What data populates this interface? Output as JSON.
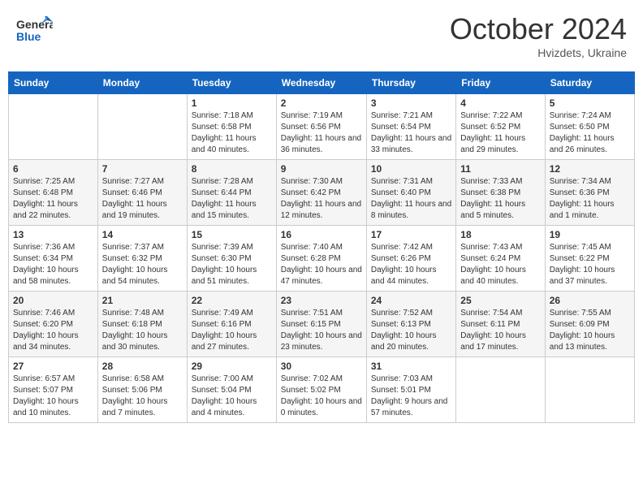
{
  "header": {
    "logo_general": "General",
    "logo_blue": "Blue",
    "month": "October 2024",
    "location": "Hvizdets, Ukraine"
  },
  "days_of_week": [
    "Sunday",
    "Monday",
    "Tuesday",
    "Wednesday",
    "Thursday",
    "Friday",
    "Saturday"
  ],
  "weeks": [
    [
      {
        "day": "",
        "sunrise": "",
        "sunset": "",
        "daylight": "",
        "empty": true
      },
      {
        "day": "",
        "sunrise": "",
        "sunset": "",
        "daylight": "",
        "empty": true
      },
      {
        "day": "1",
        "sunrise": "Sunrise: 7:18 AM",
        "sunset": "Sunset: 6:58 PM",
        "daylight": "Daylight: 11 hours and 40 minutes."
      },
      {
        "day": "2",
        "sunrise": "Sunrise: 7:19 AM",
        "sunset": "Sunset: 6:56 PM",
        "daylight": "Daylight: 11 hours and 36 minutes."
      },
      {
        "day": "3",
        "sunrise": "Sunrise: 7:21 AM",
        "sunset": "Sunset: 6:54 PM",
        "daylight": "Daylight: 11 hours and 33 minutes."
      },
      {
        "day": "4",
        "sunrise": "Sunrise: 7:22 AM",
        "sunset": "Sunset: 6:52 PM",
        "daylight": "Daylight: 11 hours and 29 minutes."
      },
      {
        "day": "5",
        "sunrise": "Sunrise: 7:24 AM",
        "sunset": "Sunset: 6:50 PM",
        "daylight": "Daylight: 11 hours and 26 minutes."
      }
    ],
    [
      {
        "day": "6",
        "sunrise": "Sunrise: 7:25 AM",
        "sunset": "Sunset: 6:48 PM",
        "daylight": "Daylight: 11 hours and 22 minutes."
      },
      {
        "day": "7",
        "sunrise": "Sunrise: 7:27 AM",
        "sunset": "Sunset: 6:46 PM",
        "daylight": "Daylight: 11 hours and 19 minutes."
      },
      {
        "day": "8",
        "sunrise": "Sunrise: 7:28 AM",
        "sunset": "Sunset: 6:44 PM",
        "daylight": "Daylight: 11 hours and 15 minutes."
      },
      {
        "day": "9",
        "sunrise": "Sunrise: 7:30 AM",
        "sunset": "Sunset: 6:42 PM",
        "daylight": "Daylight: 11 hours and 12 minutes."
      },
      {
        "day": "10",
        "sunrise": "Sunrise: 7:31 AM",
        "sunset": "Sunset: 6:40 PM",
        "daylight": "Daylight: 11 hours and 8 minutes."
      },
      {
        "day": "11",
        "sunrise": "Sunrise: 7:33 AM",
        "sunset": "Sunset: 6:38 PM",
        "daylight": "Daylight: 11 hours and 5 minutes."
      },
      {
        "day": "12",
        "sunrise": "Sunrise: 7:34 AM",
        "sunset": "Sunset: 6:36 PM",
        "daylight": "Daylight: 11 hours and 1 minute."
      }
    ],
    [
      {
        "day": "13",
        "sunrise": "Sunrise: 7:36 AM",
        "sunset": "Sunset: 6:34 PM",
        "daylight": "Daylight: 10 hours and 58 minutes."
      },
      {
        "day": "14",
        "sunrise": "Sunrise: 7:37 AM",
        "sunset": "Sunset: 6:32 PM",
        "daylight": "Daylight: 10 hours and 54 minutes."
      },
      {
        "day": "15",
        "sunrise": "Sunrise: 7:39 AM",
        "sunset": "Sunset: 6:30 PM",
        "daylight": "Daylight: 10 hours and 51 minutes."
      },
      {
        "day": "16",
        "sunrise": "Sunrise: 7:40 AM",
        "sunset": "Sunset: 6:28 PM",
        "daylight": "Daylight: 10 hours and 47 minutes."
      },
      {
        "day": "17",
        "sunrise": "Sunrise: 7:42 AM",
        "sunset": "Sunset: 6:26 PM",
        "daylight": "Daylight: 10 hours and 44 minutes."
      },
      {
        "day": "18",
        "sunrise": "Sunrise: 7:43 AM",
        "sunset": "Sunset: 6:24 PM",
        "daylight": "Daylight: 10 hours and 40 minutes."
      },
      {
        "day": "19",
        "sunrise": "Sunrise: 7:45 AM",
        "sunset": "Sunset: 6:22 PM",
        "daylight": "Daylight: 10 hours and 37 minutes."
      }
    ],
    [
      {
        "day": "20",
        "sunrise": "Sunrise: 7:46 AM",
        "sunset": "Sunset: 6:20 PM",
        "daylight": "Daylight: 10 hours and 34 minutes."
      },
      {
        "day": "21",
        "sunrise": "Sunrise: 7:48 AM",
        "sunset": "Sunset: 6:18 PM",
        "daylight": "Daylight: 10 hours and 30 minutes."
      },
      {
        "day": "22",
        "sunrise": "Sunrise: 7:49 AM",
        "sunset": "Sunset: 6:16 PM",
        "daylight": "Daylight: 10 hours and 27 minutes."
      },
      {
        "day": "23",
        "sunrise": "Sunrise: 7:51 AM",
        "sunset": "Sunset: 6:15 PM",
        "daylight": "Daylight: 10 hours and 23 minutes."
      },
      {
        "day": "24",
        "sunrise": "Sunrise: 7:52 AM",
        "sunset": "Sunset: 6:13 PM",
        "daylight": "Daylight: 10 hours and 20 minutes."
      },
      {
        "day": "25",
        "sunrise": "Sunrise: 7:54 AM",
        "sunset": "Sunset: 6:11 PM",
        "daylight": "Daylight: 10 hours and 17 minutes."
      },
      {
        "day": "26",
        "sunrise": "Sunrise: 7:55 AM",
        "sunset": "Sunset: 6:09 PM",
        "daylight": "Daylight: 10 hours and 13 minutes."
      }
    ],
    [
      {
        "day": "27",
        "sunrise": "Sunrise: 6:57 AM",
        "sunset": "Sunset: 5:07 PM",
        "daylight": "Daylight: 10 hours and 10 minutes."
      },
      {
        "day": "28",
        "sunrise": "Sunrise: 6:58 AM",
        "sunset": "Sunset: 5:06 PM",
        "daylight": "Daylight: 10 hours and 7 minutes."
      },
      {
        "day": "29",
        "sunrise": "Sunrise: 7:00 AM",
        "sunset": "Sunset: 5:04 PM",
        "daylight": "Daylight: 10 hours and 4 minutes."
      },
      {
        "day": "30",
        "sunrise": "Sunrise: 7:02 AM",
        "sunset": "Sunset: 5:02 PM",
        "daylight": "Daylight: 10 hours and 0 minutes."
      },
      {
        "day": "31",
        "sunrise": "Sunrise: 7:03 AM",
        "sunset": "Sunset: 5:01 PM",
        "daylight": "Daylight: 9 hours and 57 minutes."
      },
      {
        "day": "",
        "sunrise": "",
        "sunset": "",
        "daylight": "",
        "empty": true
      },
      {
        "day": "",
        "sunrise": "",
        "sunset": "",
        "daylight": "",
        "empty": true
      }
    ]
  ]
}
